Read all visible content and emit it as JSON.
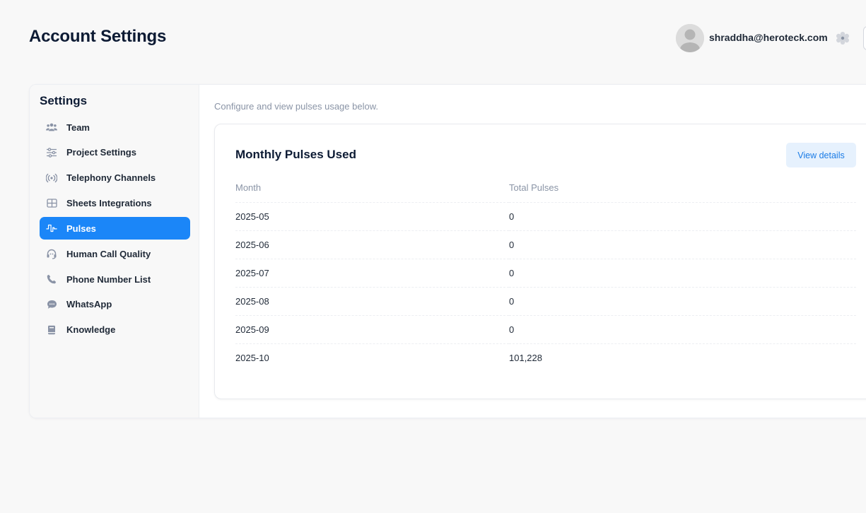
{
  "page": {
    "title": "Account Settings"
  },
  "user": {
    "email": "shraddha@heroteck.com",
    "avatar_icon": "user-avatar-icon",
    "settings_icon": "gear-icon"
  },
  "sidebar": {
    "title": "Settings",
    "items": [
      {
        "label": "Team",
        "icon": "team-icon"
      },
      {
        "label": "Project Settings",
        "icon": "sliders-icon"
      },
      {
        "label": "Telephony Channels",
        "icon": "broadcast-icon"
      },
      {
        "label": "Sheets Integrations",
        "icon": "grid-icon"
      },
      {
        "label": "Pulses",
        "icon": "pulse-icon",
        "active": true
      },
      {
        "label": "Human Call Quality",
        "icon": "headset-icon"
      },
      {
        "label": "Phone Number List",
        "icon": "phone-icon"
      },
      {
        "label": "WhatsApp",
        "icon": "chat-icon"
      },
      {
        "label": "Knowledge",
        "icon": "book-icon"
      }
    ]
  },
  "main": {
    "description": "Configure and view pulses usage below.",
    "card": {
      "title": "Monthly Pulses Used",
      "button_label": "View details",
      "columns": [
        "Month",
        "Total Pulses"
      ],
      "rows": [
        [
          "2025-05",
          "0"
        ],
        [
          "2025-06",
          "0"
        ],
        [
          "2025-07",
          "0"
        ],
        [
          "2025-08",
          "0"
        ],
        [
          "2025-09",
          "0"
        ],
        [
          "2025-10",
          "101,228"
        ]
      ]
    }
  },
  "colors": {
    "accent": "#1b86f8",
    "button_bg": "#e6f1fd",
    "muted_text": "#8a94a6"
  }
}
